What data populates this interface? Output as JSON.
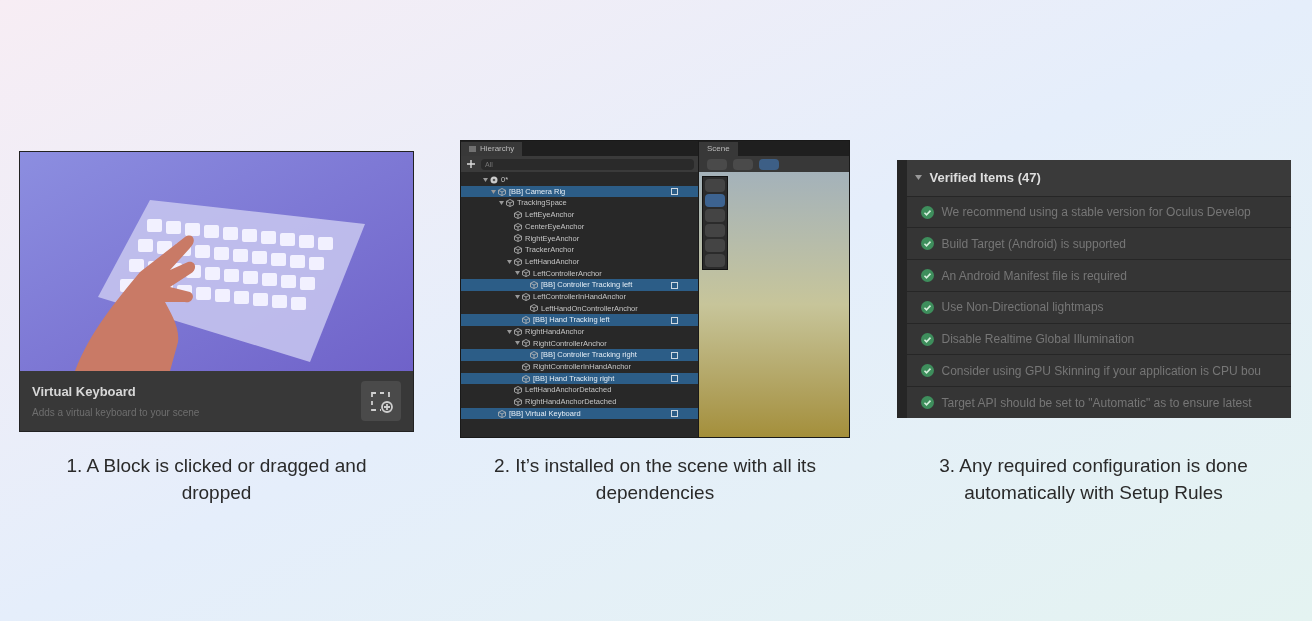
{
  "steps": [
    {
      "kind": "block",
      "caption": "1. A Block is clicked or dragged and dropped",
      "card": {
        "title": "Virtual Keyboard",
        "description": "Adds a virtual keyboard to your scene"
      }
    },
    {
      "kind": "hierarchy",
      "caption": "2. It’s installed on the scene with all its dependencies",
      "hierarchy": {
        "tab": "Hierarchy",
        "search": {
          "placeholder": "All"
        },
        "scene_tab": "Scene",
        "tree": [
          {
            "label": "0*",
            "kind": "scene",
            "selected": false,
            "children": [
              {
                "label": "[BB] Camera Rig",
                "kind": "object",
                "selected": true,
                "children": [
                  {
                    "label": "TrackingSpace",
                    "kind": "object",
                    "selected": false,
                    "children": [
                      {
                        "label": "LeftEyeAnchor",
                        "kind": "object",
                        "selected": false
                      },
                      {
                        "label": "CenterEyeAnchor",
                        "kind": "object",
                        "selected": false
                      },
                      {
                        "label": "RightEyeAnchor",
                        "kind": "object",
                        "selected": false
                      },
                      {
                        "label": "TrackerAnchor",
                        "kind": "object",
                        "selected": false
                      },
                      {
                        "label": "LeftHandAnchor",
                        "kind": "object",
                        "selected": false,
                        "children": [
                          {
                            "label": "LeftControllerAnchor",
                            "kind": "object",
                            "selected": false,
                            "children": [
                              {
                                "label": "[BB] Controller Tracking left",
                                "kind": "object",
                                "selected": true
                              }
                            ]
                          },
                          {
                            "label": "LeftControllerInHandAnchor",
                            "kind": "object",
                            "selected": false,
                            "children": [
                              {
                                "label": "LeftHandOnControllerAnchor",
                                "kind": "object",
                                "selected": false
                              }
                            ]
                          },
                          {
                            "label": "[BB] Hand Tracking left",
                            "kind": "object",
                            "selected": true
                          }
                        ]
                      },
                      {
                        "label": "RightHandAnchor",
                        "kind": "object",
                        "selected": false,
                        "children": [
                          {
                            "label": "RightControllerAnchor",
                            "kind": "object",
                            "selected": false,
                            "children": [
                              {
                                "label": "[BB] Controller Tracking right",
                                "kind": "object",
                                "selected": true
                              }
                            ]
                          },
                          {
                            "label": "RightControllerInHandAnchor",
                            "kind": "object",
                            "selected": false
                          },
                          {
                            "label": "[BB] Hand Tracking right",
                            "kind": "object",
                            "selected": true
                          }
                        ]
                      },
                      {
                        "label": "LeftHandAnchorDetached",
                        "kind": "object",
                        "selected": false
                      },
                      {
                        "label": "RightHandAnchorDetached",
                        "kind": "object",
                        "selected": false
                      }
                    ]
                  }
                ]
              },
              {
                "label": "[BB] Virtual Keyboard",
                "kind": "object",
                "selected": true
              }
            ]
          }
        ]
      }
    },
    {
      "kind": "rules",
      "caption": "3. Any required configuration is done automatically with Setup Rules",
      "rules": {
        "header": "Verified Items (47)",
        "items": [
          "We recommend using a stable version for Oculus Develop",
          "Build Target (Android) is supported",
          "An Android Manifest file is required",
          "Use Non-Directional lightmaps",
          "Disable Realtime Global Illumination",
          "Consider using GPU Skinning if your application is CPU bou",
          "Target API should be set to \"Automatic\" as to ensure latest"
        ]
      }
    }
  ]
}
